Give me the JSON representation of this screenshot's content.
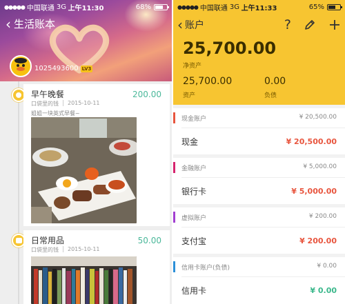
{
  "left": {
    "status_bar": {
      "carrier": "中国联通",
      "network": "3G",
      "time": "上午11:30",
      "battery": "68%",
      "battery_level": 0.68
    },
    "nav": {
      "title": "生活账本"
    },
    "user": {
      "id": "1025493600",
      "level": "LV3"
    },
    "entries": [
      {
        "title": "早午晚餐",
        "amount": "200.00",
        "account": "口袋里的钱",
        "date": "2015-10-11",
        "note": "姐姐一块英式早餐~",
        "icon": "meal-icon",
        "photo": "breakfast-photo"
      },
      {
        "title": "日常用品",
        "amount": "50.00",
        "account": "口袋里的钱",
        "date": "2015-10-11",
        "note": "",
        "icon": "shopping-icon",
        "photo": "bookshelf-photo"
      }
    ],
    "colors": {
      "income_green": "#4bb89a",
      "accent_yellow": "#f7c531"
    }
  },
  "right": {
    "status_bar": {
      "carrier": "中国联通",
      "network": "3G",
      "time": "上午11:33",
      "battery": "65%",
      "battery_level": 0.65
    },
    "nav": {
      "back_label": "账户",
      "help_icon": "question-icon",
      "edit_icon": "pencil-icon",
      "add_icon": "plus-icon"
    },
    "summary": {
      "net": "25,700.00",
      "net_label": "净资产",
      "assets": "25,700.00",
      "assets_label": "资产",
      "debt": "0.00",
      "debt_label": "负债"
    },
    "accounts": [
      {
        "category": "现金账户",
        "category_total": "¥ 20,500.00",
        "name": "现金",
        "balance": "¥ 20,500.00",
        "bar_color": "#e8553e",
        "balance_color": "#e8553e"
      },
      {
        "category": "金融账户",
        "category_total": "¥ 5,000.00",
        "name": "银行卡",
        "balance": "¥ 5,000.00",
        "bar_color": "#d6246e",
        "balance_color": "#e8553e"
      },
      {
        "category": "虚拟账户",
        "category_total": "¥ 200.00",
        "name": "支付宝",
        "balance": "¥ 200.00",
        "bar_color": "#a23fd1",
        "balance_color": "#e8553e"
      },
      {
        "category": "信用卡账户(负债)",
        "category_total": "¥ 0.00",
        "name": "信用卡",
        "balance": "¥ 0.00",
        "bar_color": "#2b8fd8",
        "balance_color": "#3cb88c"
      }
    ]
  }
}
